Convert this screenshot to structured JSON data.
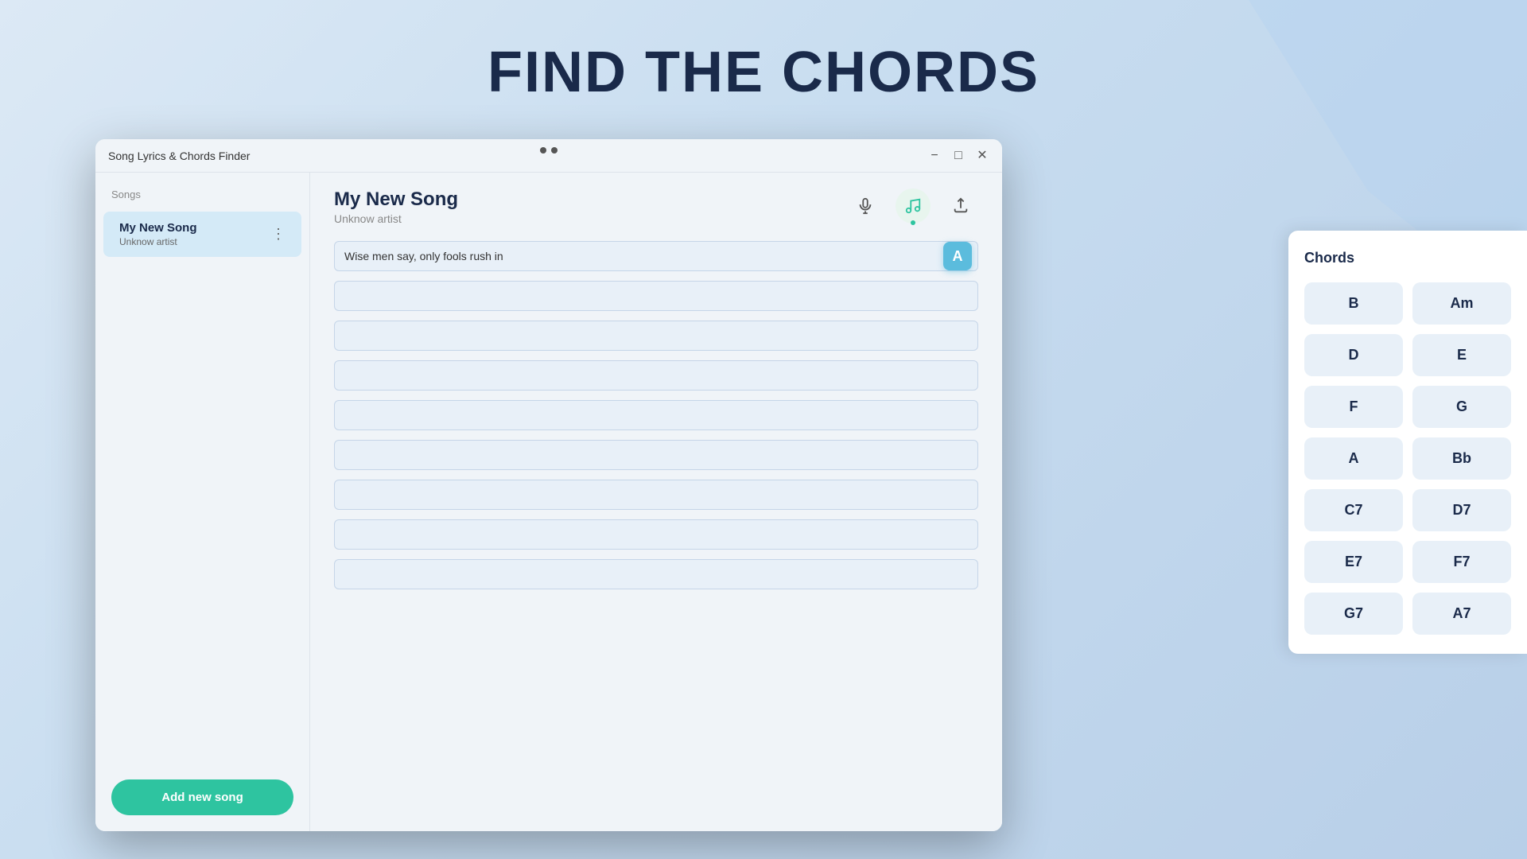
{
  "page": {
    "title": "FIND THE CHORDS",
    "background_gradient_start": "#dce9f5",
    "background_gradient_end": "#b8cfe8"
  },
  "window": {
    "title": "Song Lyrics & Chords Finder",
    "minimize_label": "−",
    "maximize_label": "□",
    "close_label": "✕"
  },
  "sidebar": {
    "section_label": "Songs",
    "songs": [
      {
        "title": "My New Song",
        "artist": "Unknow artist"
      }
    ],
    "add_song_button": "Add new song"
  },
  "song_header": {
    "title": "My New Song",
    "artist": "Unknow artist"
  },
  "toolbar": {
    "mic_icon": "🎤",
    "music_icon": "🎵",
    "share_icon": "⬆"
  },
  "editor": {
    "lines": [
      {
        "value": "Wise men say, only fools rush in",
        "placeholder": ""
      },
      {
        "value": "",
        "placeholder": ""
      },
      {
        "value": "",
        "placeholder": ""
      },
      {
        "value": "",
        "placeholder": ""
      },
      {
        "value": "",
        "placeholder": ""
      },
      {
        "value": "",
        "placeholder": ""
      },
      {
        "value": "",
        "placeholder": ""
      },
      {
        "value": "",
        "placeholder": ""
      },
      {
        "value": "",
        "placeholder": ""
      }
    ],
    "chord_badge_label": "A"
  },
  "chords_panel": {
    "title": "Chords",
    "chords": [
      "B",
      "Am",
      "D",
      "E",
      "F",
      "G",
      "A",
      "Bb",
      "C7",
      "D7",
      "E7",
      "F7",
      "G7",
      "A7"
    ]
  }
}
